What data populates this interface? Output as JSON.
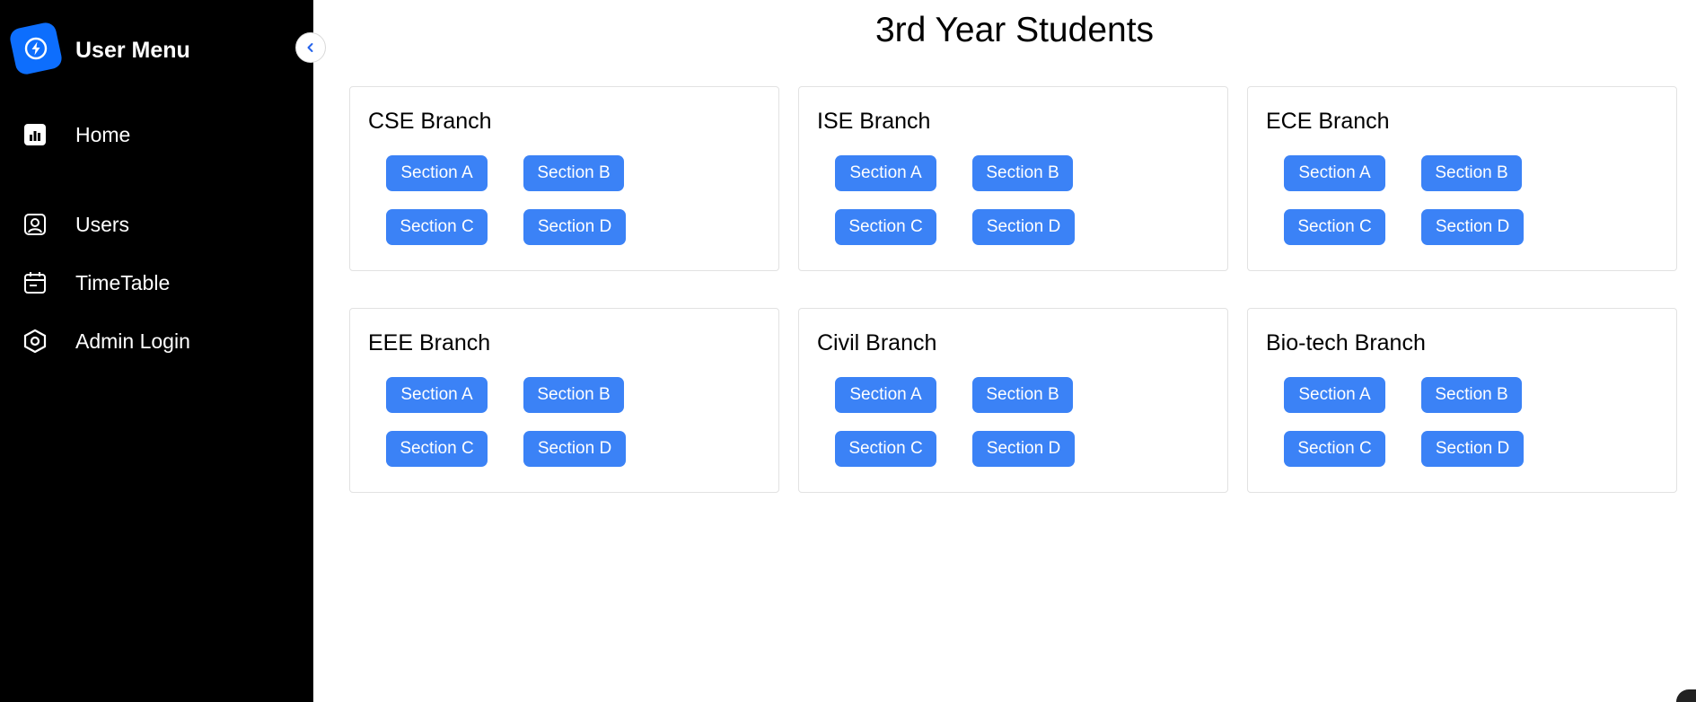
{
  "sidebar": {
    "brand": "User Menu",
    "items": [
      {
        "label": "Home",
        "icon": "bar-chart-icon"
      },
      {
        "label": "Users",
        "icon": "user-badge-icon"
      },
      {
        "label": "TimeTable",
        "icon": "calendar-icon"
      },
      {
        "label": "Admin Login",
        "icon": "hexagon-icon"
      }
    ]
  },
  "page": {
    "title": "3rd Year Students"
  },
  "branches": [
    {
      "name": "CSE Branch",
      "sections": [
        "Section A",
        "Section B",
        "Section C",
        "Section D"
      ]
    },
    {
      "name": "ISE Branch",
      "sections": [
        "Section A",
        "Section B",
        "Section C",
        "Section D"
      ]
    },
    {
      "name": "ECE Branch",
      "sections": [
        "Section A",
        "Section B",
        "Section C",
        "Section D"
      ]
    },
    {
      "name": "EEE Branch",
      "sections": [
        "Section A",
        "Section B",
        "Section C",
        "Section D"
      ]
    },
    {
      "name": "Civil Branch",
      "sections": [
        "Section A",
        "Section B",
        "Section C",
        "Section D"
      ]
    },
    {
      "name": "Bio-tech Branch",
      "sections": [
        "Section A",
        "Section B",
        "Section C",
        "Section D"
      ]
    }
  ],
  "colors": {
    "sidebar_bg": "#000000",
    "accent": "#3b82f6",
    "logo": "#0d6efd"
  }
}
